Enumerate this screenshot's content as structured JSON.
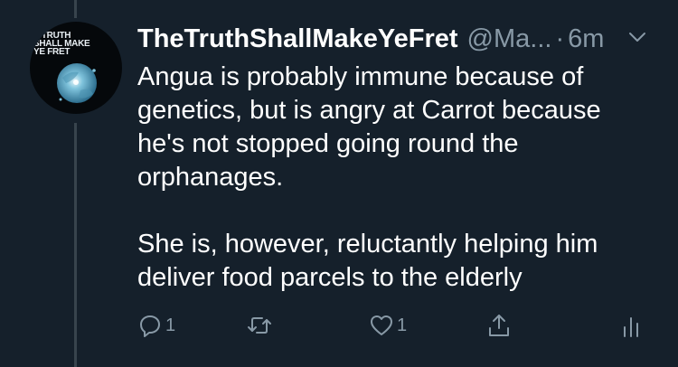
{
  "avatar": {
    "text_lines": [
      "E TRUTH",
      "SHALL MAKE",
      "YE FRET"
    ]
  },
  "tweet": {
    "display_name": "TheTruthShallMakeYeFret",
    "handle": "@Ma...",
    "separator": "·",
    "time": "6m",
    "paragraphs": [
      "Angua is probably immune because of genetics, but is angry at Carrot because he's not stopped going round the orphanages.",
      "She is, however, reluctantly helping him deliver food parcels to the elderly"
    ],
    "actions": {
      "reply_count": "1",
      "like_count": "1"
    }
  },
  "icons": {
    "reply": "reply-icon",
    "retweet": "retweet-icon",
    "like": "heart-icon",
    "share": "share-icon",
    "analytics": "analytics-icon",
    "more": "chevron-down-icon"
  },
  "colors": {
    "background": "#15202b",
    "text": "#ffffff",
    "secondary": "#8899a6",
    "thread_line": "#38444d"
  }
}
